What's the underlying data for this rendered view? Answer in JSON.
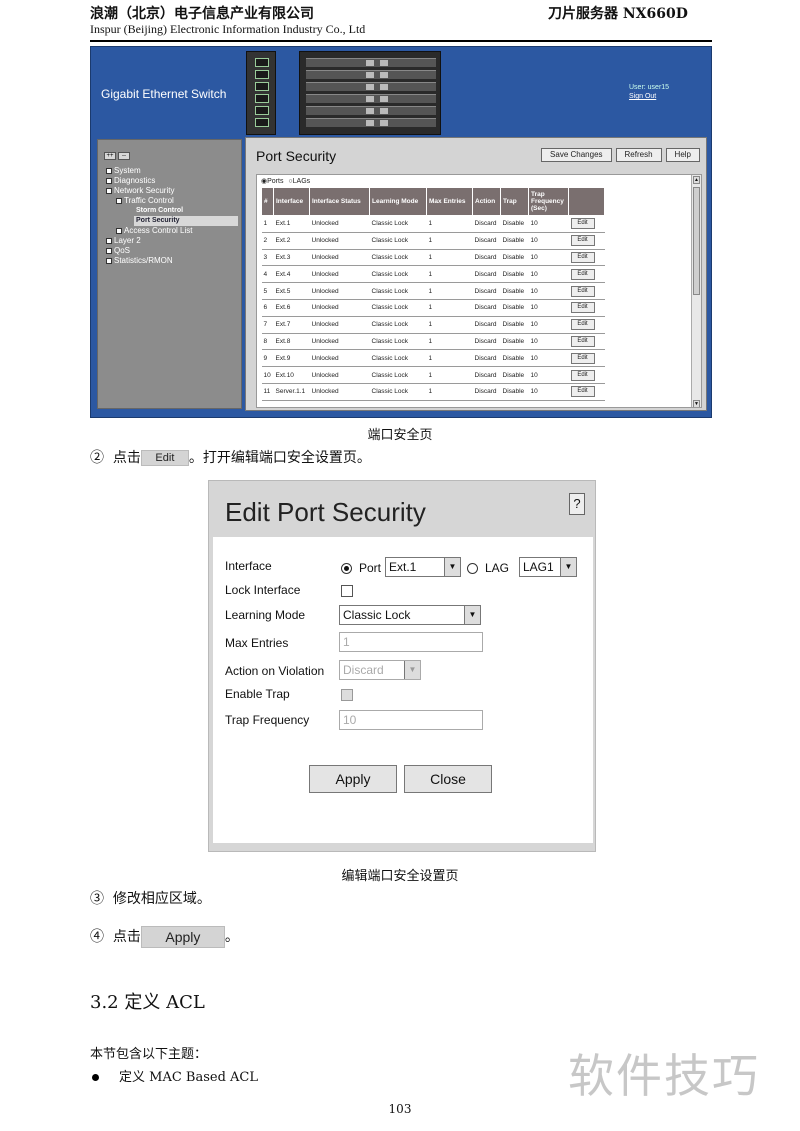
{
  "header": {
    "company_cn": "浪潮（北京）电子信息产业有限公司",
    "product": "刀片服务器 NX660D",
    "company_en": "Inspur (Beijing) Electronic Information Industry Co., Ltd"
  },
  "screenshot1": {
    "banner_title": "Gigabit Ethernet Switch",
    "user_label": "User: user15",
    "sign_out": "Sign Out",
    "expand_all": "++",
    "collapse_all": "--",
    "nav": {
      "system": "System",
      "diagnostics": "Diagnostics",
      "network_security": "Network Security",
      "traffic_control": "Traffic Control",
      "storm_control": "Storm Control",
      "port_security": "Port Security",
      "access_control_list": "Access Control List",
      "layer2": "Layer 2",
      "qos": "QoS",
      "statistics": "Statistics/RMON"
    },
    "page_title": "Port Security",
    "buttons": {
      "save": "Save Changes",
      "refresh": "Refresh",
      "help": "Help"
    },
    "radio_ports": "Ports",
    "radio_lags": "LAGs",
    "columns": [
      "#",
      "Interface",
      "Interface Status",
      "Learning Mode",
      "Max Entries",
      "Action",
      "Trap",
      "Trap Frequency (Sec)",
      ""
    ],
    "edit_label": "Edit",
    "rows": [
      [
        "1",
        "Ext.1",
        "Unlocked",
        "Classic Lock",
        "1",
        "Discard",
        "Disable",
        "10"
      ],
      [
        "2",
        "Ext.2",
        "Unlocked",
        "Classic Lock",
        "1",
        "Discard",
        "Disable",
        "10"
      ],
      [
        "3",
        "Ext.3",
        "Unlocked",
        "Classic Lock",
        "1",
        "Discard",
        "Disable",
        "10"
      ],
      [
        "4",
        "Ext.4",
        "Unlocked",
        "Classic Lock",
        "1",
        "Discard",
        "Disable",
        "10"
      ],
      [
        "5",
        "Ext.5",
        "Unlocked",
        "Classic Lock",
        "1",
        "Discard",
        "Disable",
        "10"
      ],
      [
        "6",
        "Ext.6",
        "Unlocked",
        "Classic Lock",
        "1",
        "Discard",
        "Disable",
        "10"
      ],
      [
        "7",
        "Ext.7",
        "Unlocked",
        "Classic Lock",
        "1",
        "Discard",
        "Disable",
        "10"
      ],
      [
        "8",
        "Ext.8",
        "Unlocked",
        "Classic Lock",
        "1",
        "Discard",
        "Disable",
        "10"
      ],
      [
        "9",
        "Ext.9",
        "Unlocked",
        "Classic Lock",
        "1",
        "Discard",
        "Disable",
        "10"
      ],
      [
        "10",
        "Ext.10",
        "Unlocked",
        "Classic Lock",
        "1",
        "Discard",
        "Disable",
        "10"
      ],
      [
        "11",
        "Server.1.1",
        "Unlocked",
        "Classic Lock",
        "1",
        "Discard",
        "Disable",
        "10"
      ]
    ]
  },
  "caption1": "端口安全页",
  "step2": {
    "num": "②",
    "text_before": "点击",
    "button": "Edit",
    "text_after": "。打开编辑端口安全设置页。"
  },
  "screenshot2": {
    "title": "Edit Port Security",
    "help": "?",
    "interface_label": "Interface",
    "port_label": "Port",
    "port_value": "Ext.1",
    "lag_label": "LAG",
    "lag_value": "LAG1",
    "lock_interface_label": "Lock Interface",
    "learning_mode_label": "Learning Mode",
    "learning_mode_value": "Classic Lock",
    "max_entries_label": "Max Entries",
    "max_entries_value": "1",
    "action_label": "Action on Violation",
    "action_value": "Discard",
    "enable_trap_label": "Enable Trap",
    "trap_freq_label": "Trap Frequency",
    "trap_freq_value": "10",
    "apply": "Apply",
    "close": "Close"
  },
  "caption2": "编辑端口安全设置页",
  "step3": {
    "num": "③",
    "text": "修改相应区域。"
  },
  "step4": {
    "num": "④",
    "text_before": "点击",
    "button": "Apply",
    "text_after": "。"
  },
  "section_title": "3.2 定义 ACL",
  "section_intro": "本节包含以下主题：",
  "bullet1": "定义 MAC Based ACL",
  "watermark": "软件技巧",
  "page_number": "103"
}
